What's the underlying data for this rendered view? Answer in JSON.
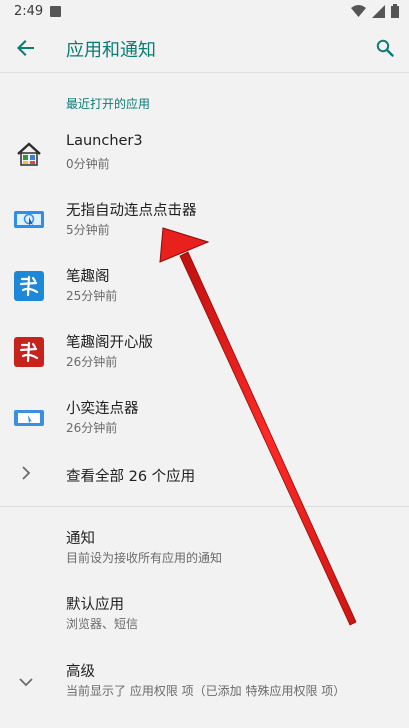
{
  "status_bar": {
    "time": "2:49"
  },
  "app_bar": {
    "title": "应用和通知"
  },
  "recent": {
    "label": "最近打开的应用",
    "apps": [
      {
        "name": "Launcher3",
        "time": "0分钟前",
        "icon": "launcher-house-icon"
      },
      {
        "name": "无指自动连点点击器",
        "time": "5分钟前",
        "icon": "auto-clicker-icon"
      },
      {
        "name": "笔趣阁",
        "time": "25分钟前",
        "icon": "biquge-icon"
      },
      {
        "name": "笔趣阁开心版",
        "time": "26分钟前",
        "icon": "biquge-happy-icon"
      },
      {
        "name": "小奕连点器",
        "time": "26分钟前",
        "icon": "xiaoyi-clicker-icon"
      }
    ],
    "see_all": "查看全部 26 个应用"
  },
  "settings": {
    "notifications": {
      "title": "通知",
      "summary": "目前设为接收所有应用的通知"
    },
    "default_apps": {
      "title": "默认应用",
      "summary": "浏览器、短信"
    },
    "advanced": {
      "title": "高级",
      "summary": "当前显示了 应用权限 项（已添加 特殊应用权限 项）"
    }
  },
  "colors": {
    "accent": "#0a7c75",
    "annotation_arrow": "#e8201e"
  }
}
